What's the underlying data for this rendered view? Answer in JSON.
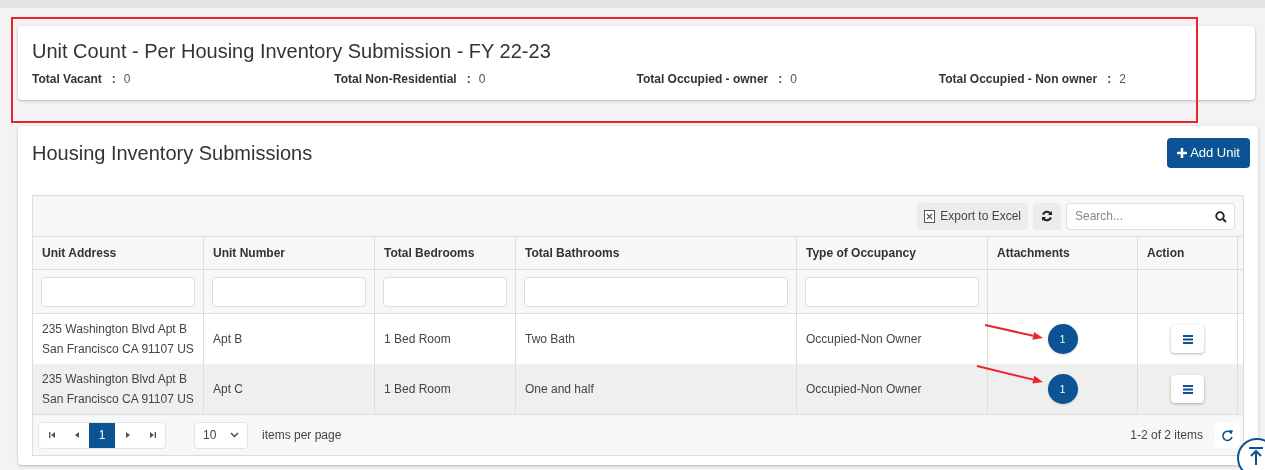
{
  "summary": {
    "title": "Unit Count - Per Housing Inventory Submission - FY 22-23",
    "stats": [
      {
        "label": "Total Vacant",
        "separator": ":",
        "value": "0"
      },
      {
        "label": "Total Non-Residential",
        "separator": ":",
        "value": "0"
      },
      {
        "label": "Total Occupied - owner",
        "separator": ":",
        "value": "0"
      },
      {
        "label": "Total Occupied - Non owner",
        "separator": ":",
        "value": "2"
      }
    ]
  },
  "submissions": {
    "title": "Housing Inventory Submissions",
    "add_button": "Add Unit",
    "toolbar": {
      "export_button": "Export to Excel",
      "search": {
        "placeholder": "Search..."
      }
    },
    "table": {
      "columns": [
        {
          "label": "Unit Address",
          "filterable": true
        },
        {
          "label": "Unit Number",
          "filterable": true
        },
        {
          "label": "Total Bedrooms",
          "filterable": true
        },
        {
          "label": "Total Bathrooms",
          "filterable": true
        },
        {
          "label": "Type of Occupancy",
          "filterable": true
        },
        {
          "label": "Attachments",
          "filterable": false
        },
        {
          "label": "Action",
          "filterable": false
        }
      ],
      "rows": [
        {
          "address": [
            "235 Washington Blvd Apt B",
            "San Francisco CA 91107 US"
          ],
          "unit": "Apt B",
          "bedrooms": "1 Bed Room",
          "bathrooms": "Two Bath",
          "occupancy": "Occupied-Non Owner",
          "attachments": "1"
        },
        {
          "address": [
            "235 Washington Blvd Apt B",
            "San Francisco CA 91107 US"
          ],
          "unit": "Apt C",
          "bedrooms": "1 Bed Room",
          "bathrooms": "One and half",
          "occupancy": "Occupied-Non Owner",
          "attachments": "1"
        }
      ]
    },
    "pager": {
      "pages": [
        {
          "label": "1",
          "selected": true
        }
      ],
      "page_size": "10",
      "page_size_label": "items per page",
      "info": "1-2 of 2 items"
    }
  },
  "annotations": [
    {
      "kind": "highlight_box"
    },
    {
      "kind": "arrow"
    },
    {
      "kind": "arrow"
    }
  ]
}
